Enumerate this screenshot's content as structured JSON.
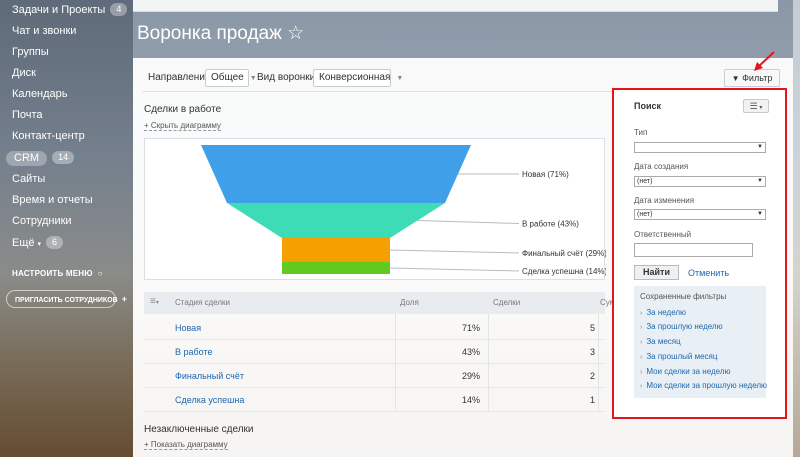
{
  "sidebar": {
    "items": [
      {
        "label": "Задачи и Проекты",
        "badge": "4"
      },
      {
        "label": "Чат и звонки"
      },
      {
        "label": "Группы"
      },
      {
        "label": "Диск"
      },
      {
        "label": "Календарь"
      },
      {
        "label": "Почта"
      },
      {
        "label": "Контакт-центр"
      },
      {
        "label": "CRM",
        "badge": "14"
      },
      {
        "label": "Сайты"
      },
      {
        "label": "Время и отчеты"
      },
      {
        "label": "Сотрудники"
      },
      {
        "label": "Ещё",
        "badge": "6"
      }
    ],
    "settings_label": "НАСТРОИТЬ МЕНЮ",
    "invite_label": "ПРИГЛАСИТЬ СОТРУДНИКОВ"
  },
  "page": {
    "title": "Воронка продаж ☆"
  },
  "toolbar": {
    "direction_label": "Направление:",
    "direction_value": "Общее",
    "funnel_label": "Вид воронки:",
    "funnel_value": "Конверсионная",
    "filter_button": "Фильтр"
  },
  "funnel": {
    "title": "Сделки в работе",
    "hide_link": "Скрыть диаграмму",
    "colors": [
      "#3f9fe8",
      "#3ddbb6",
      "#f5a000",
      "#62c91e"
    ]
  },
  "chart_data": {
    "type": "funnel",
    "categories": [
      "Новая",
      "В работе",
      "Финальный счёт",
      "Сделка успешна"
    ],
    "values": [
      71,
      43,
      29,
      14
    ],
    "labels": [
      "Новая (71%)",
      "В работе (43%)",
      "Финальный счёт (29%)",
      "Сделка успешна (14%)"
    ]
  },
  "table": {
    "headers": [
      "Стадия сделки",
      "Доля",
      "Сделки",
      "Сум"
    ],
    "rows": [
      {
        "name": "Новая",
        "share": "71%",
        "deals": "5"
      },
      {
        "name": "В работе",
        "share": "43%",
        "deals": "3"
      },
      {
        "name": "Финальный счёт",
        "share": "29%",
        "deals": "2"
      },
      {
        "name": "Сделка успешна",
        "share": "14%",
        "deals": "1"
      }
    ]
  },
  "unclosed": {
    "title": "Незаключенные сделки",
    "show_link": "Показать диаграмму"
  },
  "filter_popup": {
    "title": "Поиск",
    "type_label": "Тип",
    "type_value": "",
    "created_label": "Дата создания",
    "created_value": "(нет)",
    "modified_label": "Дата изменения",
    "modified_value": "(нет)",
    "responsible_label": "Ответственный",
    "find_button": "Найти",
    "cancel_link": "Отменить",
    "saved_title": "Сохраненные фильтры",
    "saved_items": [
      "За неделю",
      "За прошлую неделю",
      "За месяц",
      "За прошлый месяц",
      "Мои сделки за неделю",
      "Мои сделки за прошлую неделю"
    ]
  }
}
